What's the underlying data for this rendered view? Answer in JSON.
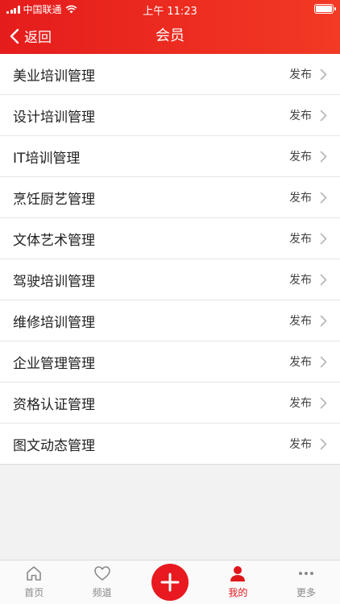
{
  "status_bar": {
    "carrier": "中国联通",
    "time": "上午 11:23"
  },
  "nav": {
    "back_label": "返回",
    "title": "会员"
  },
  "list": {
    "action_label": "发布",
    "items": [
      {
        "title": "美业培训管理"
      },
      {
        "title": "设计培训管理"
      },
      {
        "title": "IT培训管理"
      },
      {
        "title": "烹饪厨艺管理"
      },
      {
        "title": "文体艺术管理"
      },
      {
        "title": "驾驶培训管理"
      },
      {
        "title": "维修培训管理"
      },
      {
        "title": "企业管理管理"
      },
      {
        "title": "资格认证管理"
      },
      {
        "title": "图文动态管理"
      }
    ]
  },
  "tabbar": {
    "home": "首页",
    "channel": "频道",
    "mine": "我的",
    "more": "更多",
    "active": "mine"
  },
  "colors": {
    "accent": "#e51c1c",
    "active_tab": "#e0161c",
    "inactive_tab": "#888888"
  }
}
